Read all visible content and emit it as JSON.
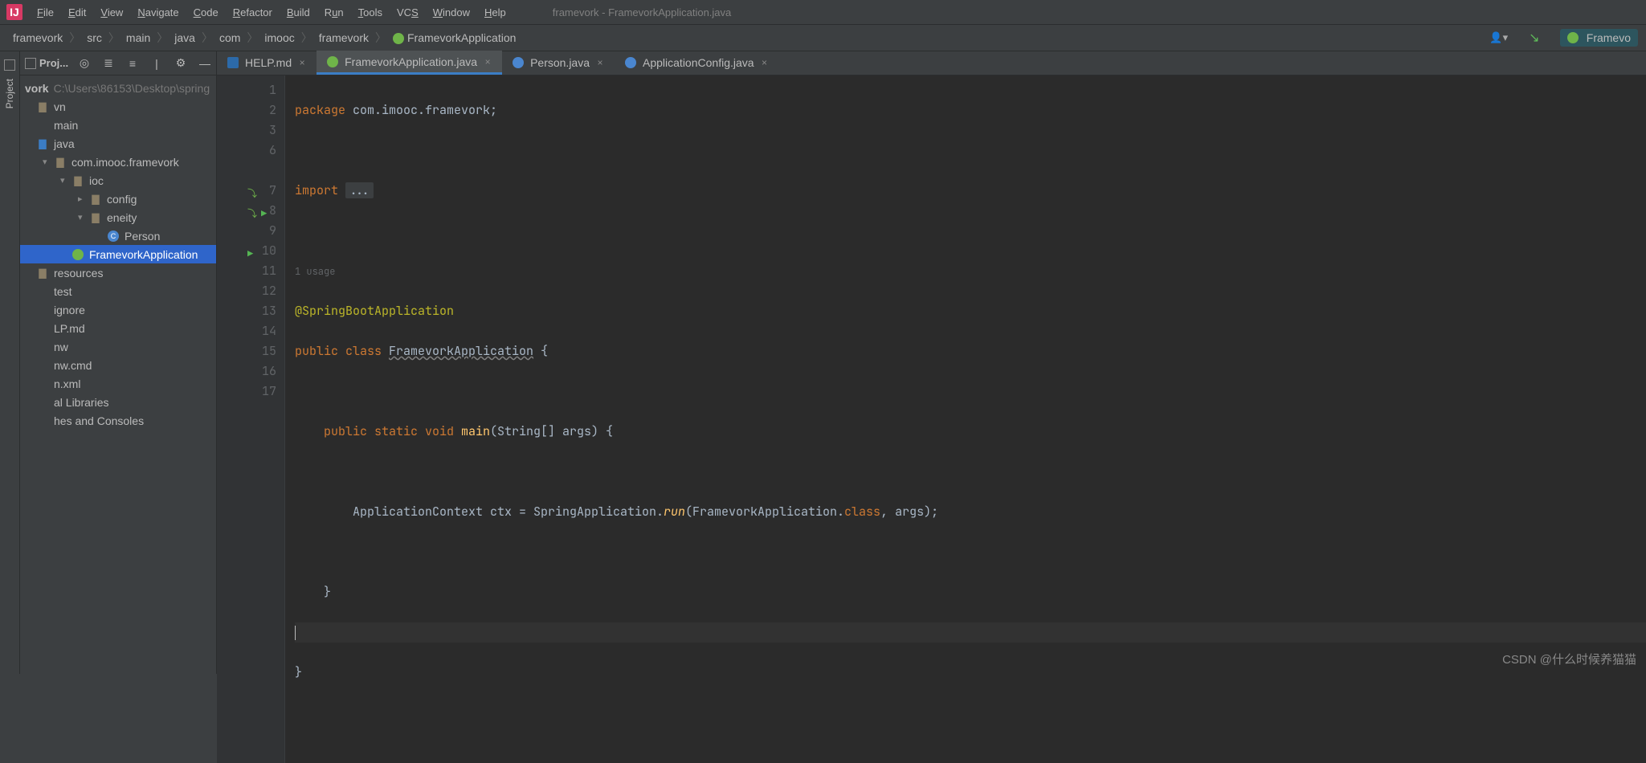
{
  "menu": [
    "File",
    "Edit",
    "View",
    "Navigate",
    "Code",
    "Refactor",
    "Build",
    "Run",
    "Tools",
    "VCS",
    "Window",
    "Help"
  ],
  "window_title": "framevork - FramevorkApplication.java",
  "breadcrumbs": [
    "framevork",
    "src",
    "main",
    "java",
    "com",
    "imooc",
    "framevork",
    "FramevorkApplication"
  ],
  "run_config": "Framevo",
  "toolstrip": {
    "project_label": "Project"
  },
  "project_panel": {
    "header_title": "Proj...",
    "root_name": "vork",
    "root_path": "C:\\Users\\86153\\Desktop\\spring",
    "items": [
      {
        "label": "vn",
        "indent": 0,
        "icon": "folder"
      },
      {
        "label": "main",
        "indent": 0,
        "icon": ""
      },
      {
        "label": "java",
        "indent": 0,
        "icon": "folder-blue"
      },
      {
        "label": "com.imooc.framevork",
        "indent": 1,
        "icon": "folder",
        "arrow": "down"
      },
      {
        "label": "ioc",
        "indent": 2,
        "icon": "folder",
        "arrow": "down"
      },
      {
        "label": "config",
        "indent": 3,
        "icon": "folder",
        "arrow": "right"
      },
      {
        "label": "eneity",
        "indent": 3,
        "icon": "folder",
        "arrow": "down"
      },
      {
        "label": "Person",
        "indent": 4,
        "icon": "class"
      },
      {
        "label": "FramevorkApplication",
        "indent": 2,
        "icon": "springboot",
        "selected": true
      },
      {
        "label": "resources",
        "indent": 0,
        "icon": "folder"
      },
      {
        "label": "test",
        "indent": 0,
        "icon": ""
      },
      {
        "label": "ignore",
        "indent": 0,
        "icon": ""
      },
      {
        "label": "LP.md",
        "indent": 0,
        "icon": ""
      },
      {
        "label": "nw",
        "indent": 0,
        "icon": ""
      },
      {
        "label": "nw.cmd",
        "indent": 0,
        "icon": ""
      },
      {
        "label": "n.xml",
        "indent": 0,
        "icon": ""
      },
      {
        "label": "al Libraries",
        "indent": 0,
        "icon": ""
      },
      {
        "label": "hes and Consoles",
        "indent": 0,
        "icon": ""
      }
    ]
  },
  "tabs": [
    {
      "label": "HELP.md",
      "icon": "md",
      "active": false
    },
    {
      "label": "FramevorkApplication.java",
      "icon": "sb",
      "active": true
    },
    {
      "label": "Person.java",
      "icon": "j",
      "active": false
    },
    {
      "label": "ApplicationConfig.java",
      "icon": "j",
      "active": false
    }
  ],
  "code": {
    "line_numbers": [
      "1",
      "2",
      "3",
      "6",
      "",
      "7",
      "8",
      "9",
      "10",
      "11",
      "12",
      "13",
      "14",
      "15",
      "16",
      "17"
    ],
    "usage_hint": "1 usage",
    "lines": {
      "l1_kw": "package",
      "l1_rest": " com.imooc.framevork;",
      "l3_kw": "import",
      "l3_fold": "...",
      "l7_ann": "@SpringBootApplication",
      "l8_kw": "public class ",
      "l8_cls": "FramevorkApplication",
      "l8_rest": " {",
      "l10_kw": "public static void ",
      "l10_fn": "main",
      "l10_rest": "(String[] args) {",
      "l12_a": "        ApplicationContext ctx = SpringApplication.",
      "l12_fn": "run",
      "l12_b": "(FramevorkApplication.",
      "l12_kw": "class",
      "l12_c": ", args);",
      "l14": "    }",
      "l16": "}"
    }
  },
  "watermark": "CSDN @什么时候养猫猫"
}
